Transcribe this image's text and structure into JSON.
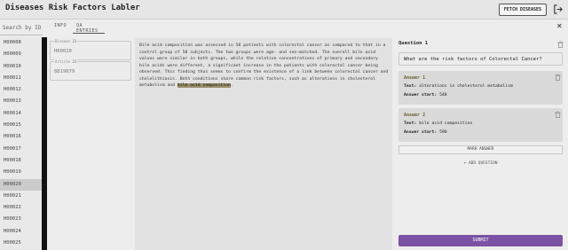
{
  "header": {
    "title": "Diseases Risk Factors Labler",
    "fetch_label": "FETCH DISEASES"
  },
  "sidebar": {
    "search_placeholder": "Search by ID",
    "selected_id": "H00020",
    "ids": [
      "H00008",
      "H00009",
      "H00010",
      "H00011",
      "H00012",
      "H00013",
      "H00014",
      "H00015",
      "H00016",
      "H00017",
      "H00018",
      "H00019",
      "H00020",
      "H00021",
      "H00022",
      "H00023",
      "H00024",
      "H00025"
    ]
  },
  "tabs": [
    "INFO",
    "QA ENTRIES"
  ],
  "info": {
    "disease_id_label": "Disease ID",
    "disease_id_value": "H00020",
    "article_id_label": "Article ID",
    "article_id_value": "8819079"
  },
  "article": {
    "text_before": "Bile acid composition was assessed in 50 patients with colorectal cancer as compared to that in a control group of 50 subjects. The two groups were age- and sex-matched. The overall bile acid values were similar in both groups, while the relative concentrations of primary and secondary bile acids were different, a significant increase in the patients with colorectal cancer being observed. This finding thus seems to confirm the existence of a link between colorectal cancer and cholelithiasis. Both conditions share common risk factors, such as alterations in cholesterol metabolism and ",
    "highlight": "bile acid composition",
    "text_after": "."
  },
  "qa": {
    "question_label": "Question 1",
    "question_text": "What are the risk factors of Colorectal Cancer?",
    "answers": [
      {
        "title": "Answer 1",
        "text_label": "Text:",
        "text": "alterations in cholesterol metabolism",
        "start_label": "Answer start:",
        "start": "548"
      },
      {
        "title": "Answer 2",
        "text_label": "Text:",
        "text": "bile acid composition",
        "start_label": "Answer start:",
        "start": "590"
      }
    ],
    "mark_answer_label": "MARK ANSWER",
    "add_question_label": "+ ADD QUESTION",
    "submit_label": "SUBMIT"
  },
  "colors": {
    "accent": "#7c52a5",
    "highlight": "#9a8f6a",
    "answer_title": "#6a5d2e"
  }
}
